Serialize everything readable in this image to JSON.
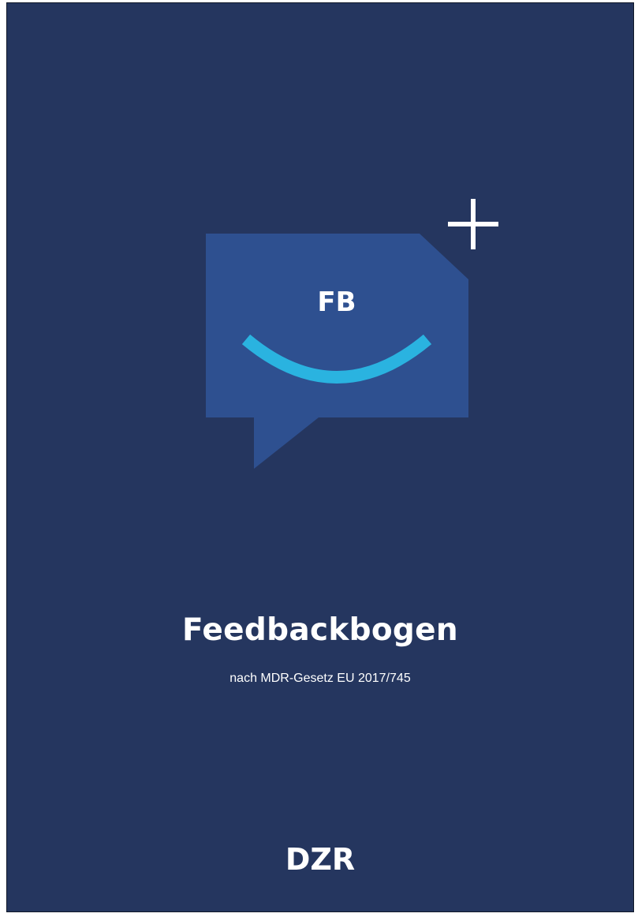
{
  "logo": {
    "initials": "FB",
    "plus_icon": "plus-icon",
    "bubble_icon": "speech-bubble-icon",
    "smile_icon": "smile-arc-icon"
  },
  "title": "Feedbackbogen",
  "subtitle": "nach MDR-Gesetz EU 2017/745",
  "brand": {
    "text": "DZR"
  },
  "colors": {
    "background": "#25365f",
    "bubble": "#2e5090",
    "smile": "#2ab3e0",
    "text": "#ffffff"
  }
}
